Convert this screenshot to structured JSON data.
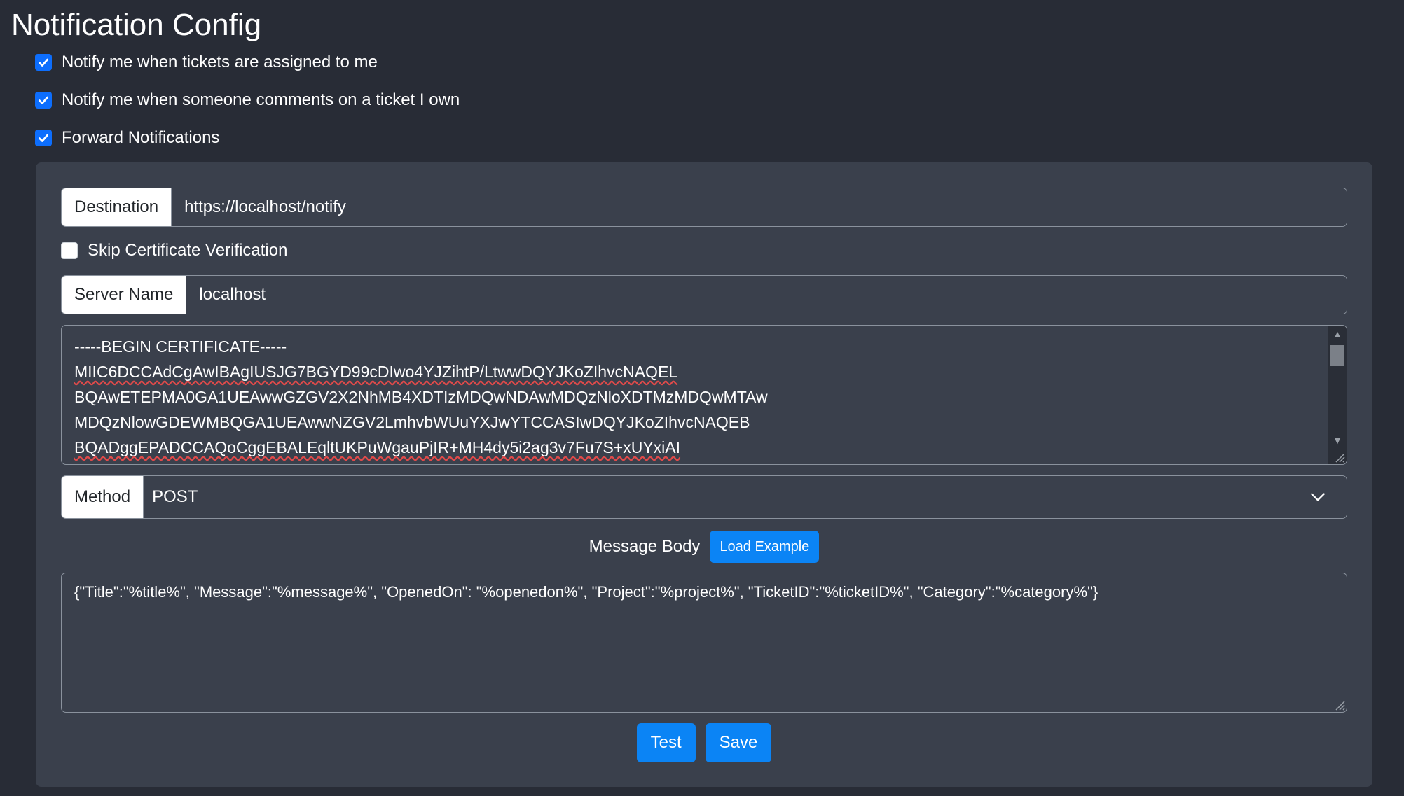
{
  "page": {
    "title": "Notification Config"
  },
  "options": [
    {
      "label": "Notify me when tickets are assigned to me",
      "checked": true
    },
    {
      "label": "Notify me when someone comments on a ticket I own",
      "checked": true
    },
    {
      "label": "Forward Notifications",
      "checked": true
    }
  ],
  "forward": {
    "destination_label": "Destination",
    "destination_value": "https://localhost/notify",
    "skip_cert_label": "Skip Certificate Verification",
    "skip_cert_checked": false,
    "server_name_label": "Server Name",
    "server_name_value": "localhost",
    "certificate_lines": [
      "-----BEGIN CERTIFICATE-----",
      "MIIC6DCCAdCgAwIBAgIUSJG7BGYD99cDIwo4YJZihtP/LtwwDQYJKoZIhvcNAQEL",
      "BQAwETEPMA0GA1UEAwwGZGV2X2NhMB4XDTIzMDQwNDAwMDQzNloXDTMzMDQwMTAw",
      "MDQzNlowGDEWMBQGA1UEAwwNZGV2LmhvbWUuYXJwYTCCASIwDQYJKoZIhvcNAQEB",
      "BQADggEPADCCAQoCggEBALEqltUKPuWgauPjIR+MH4dy5i2ag3v7Fu7S+xUYxiAI"
    ],
    "method_label": "Method",
    "method_value": "POST",
    "message_body_label": "Message Body",
    "load_example_label": "Load Example",
    "message_body_value": "{\"Title\":\"%title%\", \"Message\":\"%message%\", \"OpenedOn\": \"%openedon%\", \"Project\":\"%project%\", \"TicketID\":\"%ticketID%\", \"Category\":\"%category%\"}",
    "test_label": "Test",
    "save_label": "Save"
  },
  "colors": {
    "background": "#282c36",
    "panel": "#3a404c",
    "accent": "#0b84f5",
    "checkbox_checked": "#0d6efd"
  },
  "icons": {
    "checkbox": "check-icon",
    "method_select": "chevron-down-icon",
    "scroll_up": "arrow-up-icon",
    "scroll_down": "arrow-down-icon"
  }
}
